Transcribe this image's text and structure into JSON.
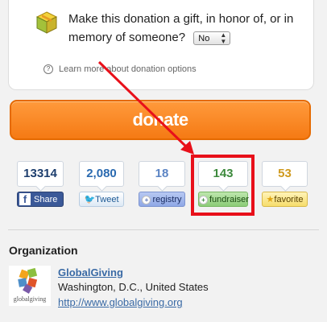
{
  "donation_options": {
    "gift_prompt": "Make this donation a gift, in honor of, or in memory of someone?",
    "gift_select_value": "No",
    "learn_more_link": "Learn more about donation options"
  },
  "donate_button_label": "donate",
  "social": [
    {
      "count": "13314",
      "button": "Share"
    },
    {
      "count": "2,080",
      "button": "Tweet"
    },
    {
      "count": "18",
      "button": "registry"
    },
    {
      "count": "143",
      "button": "fundraiser"
    },
    {
      "count": "53",
      "button": "favorite"
    }
  ],
  "organization": {
    "heading": "Organization",
    "logo_text": "globalgiving",
    "name": "GlobalGiving",
    "location": "Washington, D.C., United States",
    "url": "http://www.globalgiving.org"
  },
  "colors": {
    "donate_orange": "#f57a14",
    "annotation_red": "#e8101a",
    "link_blue": "#3a6aa5",
    "facebook_blue": "#3b5998"
  },
  "icons": [
    "gift-box-icon",
    "question-icon",
    "facebook-icon",
    "twitter-bird-icon",
    "registry-icon",
    "fundraiser-icon",
    "star-icon"
  ]
}
